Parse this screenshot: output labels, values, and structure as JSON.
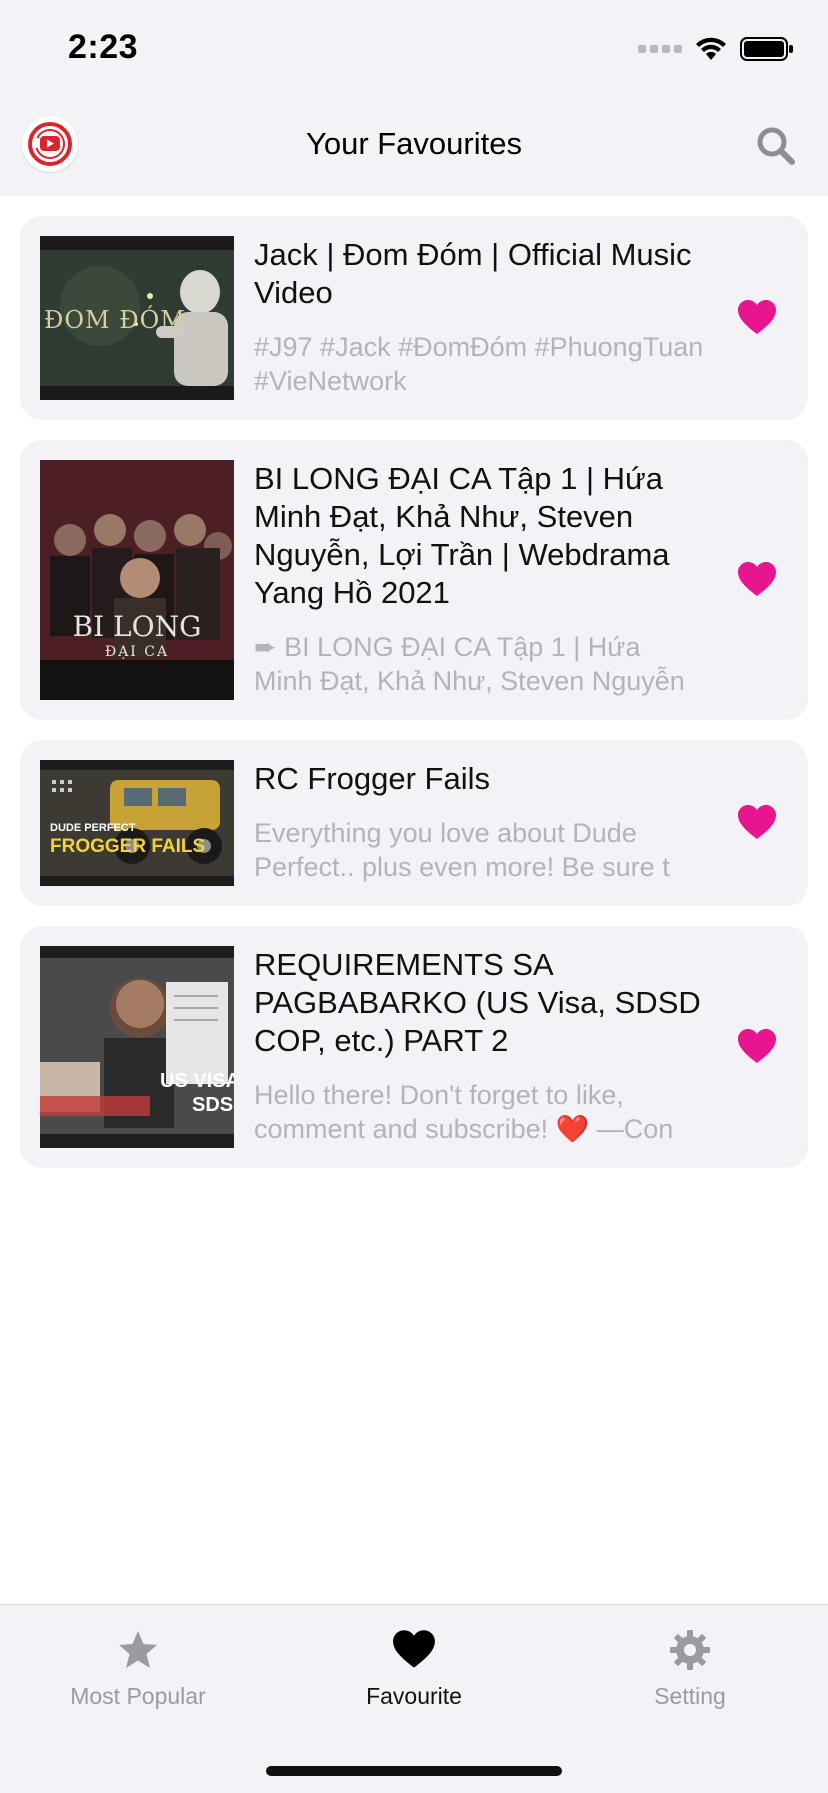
{
  "status_bar": {
    "time": "2:23"
  },
  "header": {
    "title": "Your Favourites"
  },
  "colors": {
    "accent_heart": "#e8168e",
    "logo_red": "#d9252f",
    "background_grey": "#f2f2f7"
  },
  "videos": [
    {
      "title": "Jack | Đom Đóm | Official Music Video",
      "description": "#J97 #Jack #ĐomĐóm #PhuongTuan #VieNetwork",
      "favourite": true
    },
    {
      "title": "BI LONG ĐẠI CA Tập 1 | Hứa Minh Đạt, Khả Như, Steven Nguyễn, Lợi Trần | Webdrama Yang Hồ 2021",
      "description": "➨ BI LONG ĐẠI CA Tập 1 | Hứa Minh Đạt, Khả Như, Steven Nguyễn",
      "favourite": true
    },
    {
      "title": "RC Frogger Fails",
      "description": "Everything you love about Dude Perfect.. plus even more!  Be sure t",
      "favourite": true
    },
    {
      "title": "REQUIREMENTS SA PAGBABARKO (US Visa, SDSD COP, etc.) PART 2",
      "description": "Hello there! Don't forget to like, comment and subscribe! ❤️ —Con",
      "favourite": true
    }
  ],
  "thumbnails": [
    {
      "caption": "ĐOM ĐÓM",
      "icon": "music-video-thumbnail"
    },
    {
      "caption": "BI LONG",
      "subcaption": "ĐẠI CA",
      "icon": "drama-thumbnail"
    },
    {
      "caption": "DUDE PERFECT",
      "subcaption": "FROGGER FAILS",
      "icon": "rc-car-thumbnail"
    },
    {
      "caption": "US VISA",
      "subcaption": "SDSD C",
      "icon": "vlog-thumbnail"
    }
  ],
  "tabs": [
    {
      "label": "Most Popular",
      "icon": "star-icon",
      "active": false
    },
    {
      "label": "Favourite",
      "icon": "heart-icon",
      "active": true
    },
    {
      "label": "Setting",
      "icon": "gear-icon",
      "active": false
    }
  ]
}
